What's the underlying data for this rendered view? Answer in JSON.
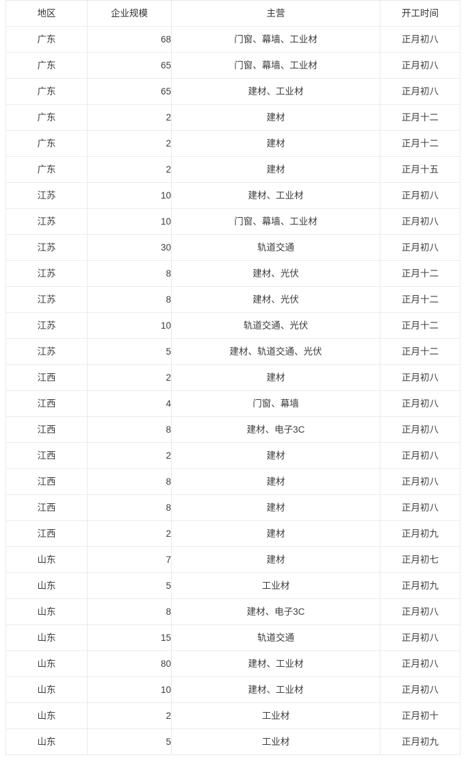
{
  "table": {
    "columns": [
      {
        "key": "region",
        "label": "地区",
        "align": "center"
      },
      {
        "key": "scale",
        "label": "企业规模",
        "align": "right"
      },
      {
        "key": "biz",
        "label": "主营",
        "align": "center"
      },
      {
        "key": "date",
        "label": "开工时间",
        "align": "center"
      }
    ],
    "rows": [
      {
        "region": "广东",
        "scale": "68",
        "biz": "门窗、幕墙、工业材",
        "date": "正月初八"
      },
      {
        "region": "广东",
        "scale": "65",
        "biz": "门窗、幕墙、工业材",
        "date": "正月初八"
      },
      {
        "region": "广东",
        "scale": "65",
        "biz": "建材、工业材",
        "date": "正月初八"
      },
      {
        "region": "广东",
        "scale": "2",
        "biz": "建材",
        "date": "正月十二"
      },
      {
        "region": "广东",
        "scale": "2",
        "biz": "建材",
        "date": "正月十二"
      },
      {
        "region": "广东",
        "scale": "2",
        "biz": "建材",
        "date": "正月十五"
      },
      {
        "region": "江苏",
        "scale": "10",
        "biz": "建材、工业材",
        "date": "正月初八"
      },
      {
        "region": "江苏",
        "scale": "10",
        "biz": "门窗、幕墙、工业材",
        "date": "正月初八"
      },
      {
        "region": "江苏",
        "scale": "30",
        "biz": "轨道交通",
        "date": "正月初八"
      },
      {
        "region": "江苏",
        "scale": "8",
        "biz": "建材、光伏",
        "date": "正月十二"
      },
      {
        "region": "江苏",
        "scale": "8",
        "biz": "建材、光伏",
        "date": "正月十二"
      },
      {
        "region": "江苏",
        "scale": "10",
        "biz": "轨道交通、光伏",
        "date": "正月十二"
      },
      {
        "region": "江苏",
        "scale": "5",
        "biz": "建材、轨道交通、光伏",
        "date": "正月十二"
      },
      {
        "region": "江西",
        "scale": "2",
        "biz": "建材",
        "date": "正月初八"
      },
      {
        "region": "江西",
        "scale": "4",
        "biz": "门窗、幕墙",
        "date": "正月初八"
      },
      {
        "region": "江西",
        "scale": "8",
        "biz": "建材、电子3C",
        "date": "正月初八"
      },
      {
        "region": "江西",
        "scale": "2",
        "biz": "建材",
        "date": "正月初八"
      },
      {
        "region": "江西",
        "scale": "8",
        "biz": "建材",
        "date": "正月初八"
      },
      {
        "region": "江西",
        "scale": "8",
        "biz": "建材",
        "date": "正月初八"
      },
      {
        "region": "江西",
        "scale": "2",
        "biz": "建材",
        "date": "正月初九"
      },
      {
        "region": "山东",
        "scale": "7",
        "biz": "建材",
        "date": "正月初七"
      },
      {
        "region": "山东",
        "scale": "5",
        "biz": "工业材",
        "date": "正月初九"
      },
      {
        "region": "山东",
        "scale": "8",
        "biz": "建材、电子3C",
        "date": "正月初八"
      },
      {
        "region": "山东",
        "scale": "15",
        "biz": "轨道交通",
        "date": "正月初八"
      },
      {
        "region": "山东",
        "scale": "80",
        "biz": "建材、工业材",
        "date": "正月初八"
      },
      {
        "region": "山东",
        "scale": "10",
        "biz": "建材、工业材",
        "date": "正月初八"
      },
      {
        "region": "山东",
        "scale": "2",
        "biz": "工业材",
        "date": "正月初十"
      },
      {
        "region": "山东",
        "scale": "5",
        "biz": "工业材",
        "date": "正月初九"
      }
    ]
  },
  "colors": {
    "border": "#e9e9e9",
    "row_separator": "#ececec",
    "text": "#3c3c3c",
    "header_text": "#333333",
    "background": "#ffffff"
  }
}
